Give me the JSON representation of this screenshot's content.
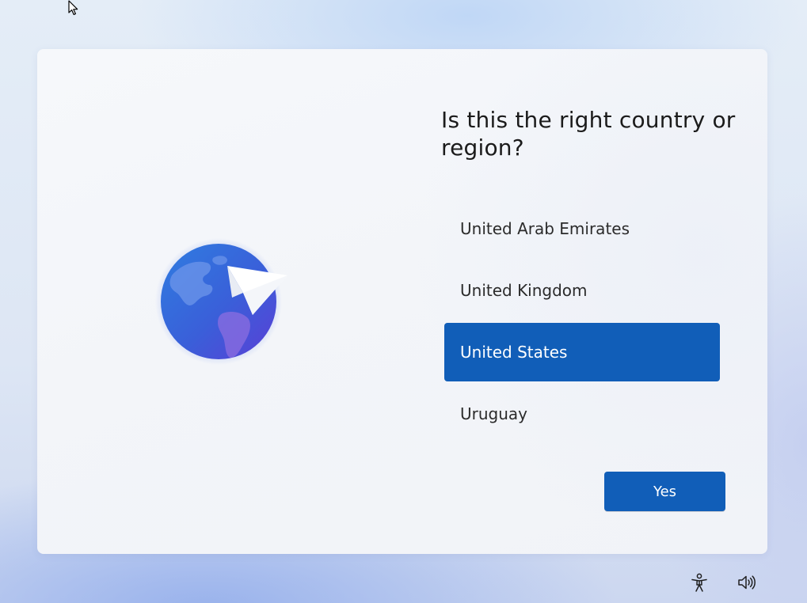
{
  "oobe": {
    "title": "Is this the right country or region?",
    "countries": [
      {
        "label": "United Arab Emirates",
        "selected": false
      },
      {
        "label": "United Kingdom",
        "selected": false
      },
      {
        "label": "United States",
        "selected": true
      },
      {
        "label": "Uruguay",
        "selected": false
      }
    ],
    "confirm_label": "Yes"
  },
  "tray": {
    "icons": [
      "accessibility-icon",
      "volume-icon"
    ]
  },
  "colors": {
    "accent": "#115eb8",
    "panel": "#f3f5f9"
  }
}
